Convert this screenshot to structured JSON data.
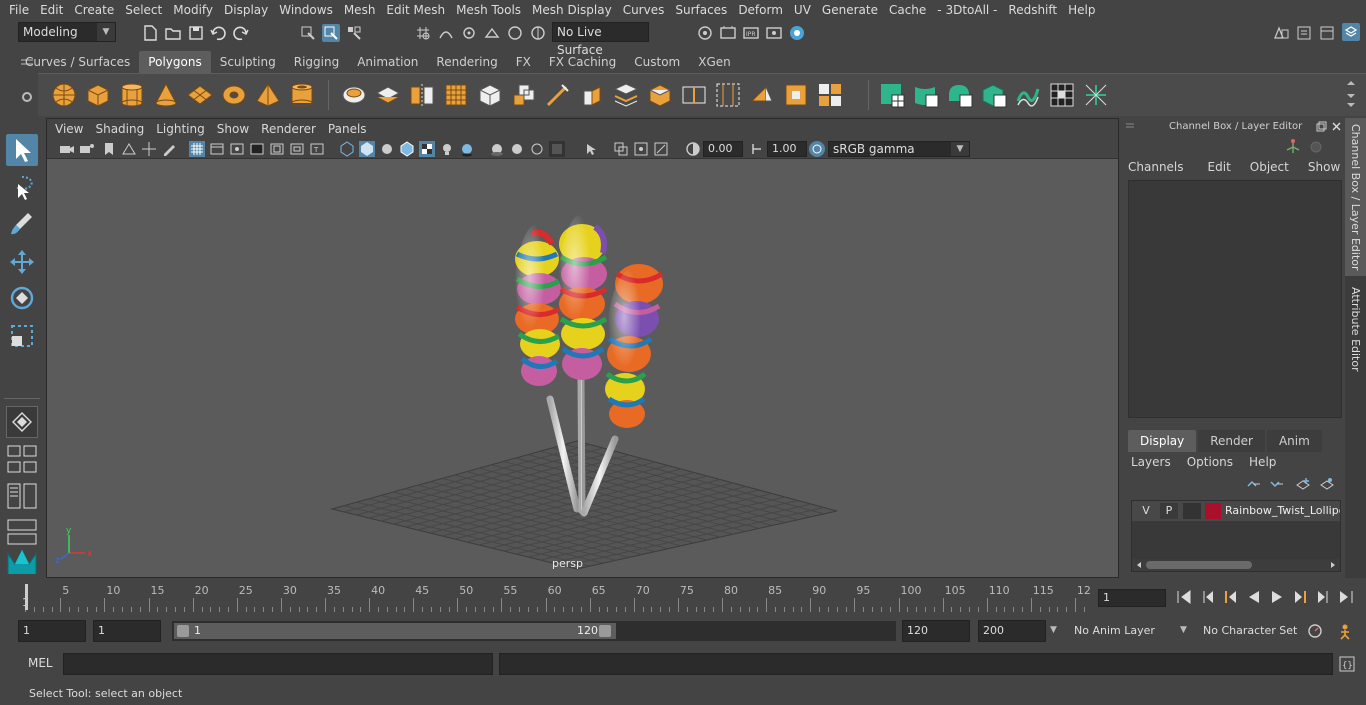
{
  "menubar": {
    "items": [
      "File",
      "Edit",
      "Create",
      "Select",
      "Modify",
      "Display",
      "Windows",
      "Mesh",
      "Edit Mesh",
      "Mesh Tools",
      "Mesh Display",
      "Curves",
      "Surfaces",
      "Deform",
      "UV",
      "Generate",
      "Cache",
      "- 3DtoAll -",
      "Redshift",
      "Help"
    ]
  },
  "statusline": {
    "mode": "Modeling",
    "live_surface": "No Live Surface"
  },
  "shelf": {
    "tabs": [
      "Curves / Surfaces",
      "Polygons",
      "Sculpting",
      "Rigging",
      "Animation",
      "Rendering",
      "FX",
      "FX Caching",
      "Custom",
      "XGen"
    ],
    "active_tab": "Polygons"
  },
  "viewport": {
    "menu": [
      "View",
      "Shading",
      "Lighting",
      "Show",
      "Renderer",
      "Panels"
    ],
    "exposure": "0.00",
    "gamma": "1.00",
    "color_space": "sRGB gamma",
    "camera_label": "persp"
  },
  "channelbox": {
    "title": "Channel Box / Layer Editor",
    "menu": [
      "Channels",
      "Edit",
      "Object",
      "Show"
    ],
    "layer_tabs": [
      "Display",
      "Render",
      "Anim"
    ],
    "active_layer_tab": "Display",
    "layer_menu": [
      "Layers",
      "Options",
      "Help"
    ],
    "layer": {
      "v": "V",
      "p": "P",
      "name": "Rainbow_Twist_Lollipo",
      "color": "#a8102c"
    }
  },
  "vertical_tabs": [
    "Channel Box / Layer Editor",
    "Attribute Editor"
  ],
  "timeslider": {
    "labels": [
      "5",
      "10",
      "15",
      "20",
      "25",
      "30",
      "35",
      "40",
      "45",
      "50",
      "55",
      "60",
      "65",
      "70",
      "75",
      "80",
      "85",
      "90",
      "95",
      "100",
      "105",
      "110",
      "115",
      "12"
    ],
    "start_marker": "1",
    "current_frame": "1"
  },
  "rangeslider": {
    "start": "1",
    "playback_start": "1",
    "range_start_label": "1",
    "range_end_label": "120",
    "playback_end": "120",
    "end": "200",
    "anim_layer": "No Anim Layer",
    "character_set": "No Character Set"
  },
  "cmdline": {
    "language": "MEL"
  },
  "helpline": {
    "text": "Select Tool: select an object"
  },
  "colors": {
    "accent": "#5285a6",
    "shelf_icon": "#e8a13c",
    "shelf_green": "#2fb58b"
  }
}
